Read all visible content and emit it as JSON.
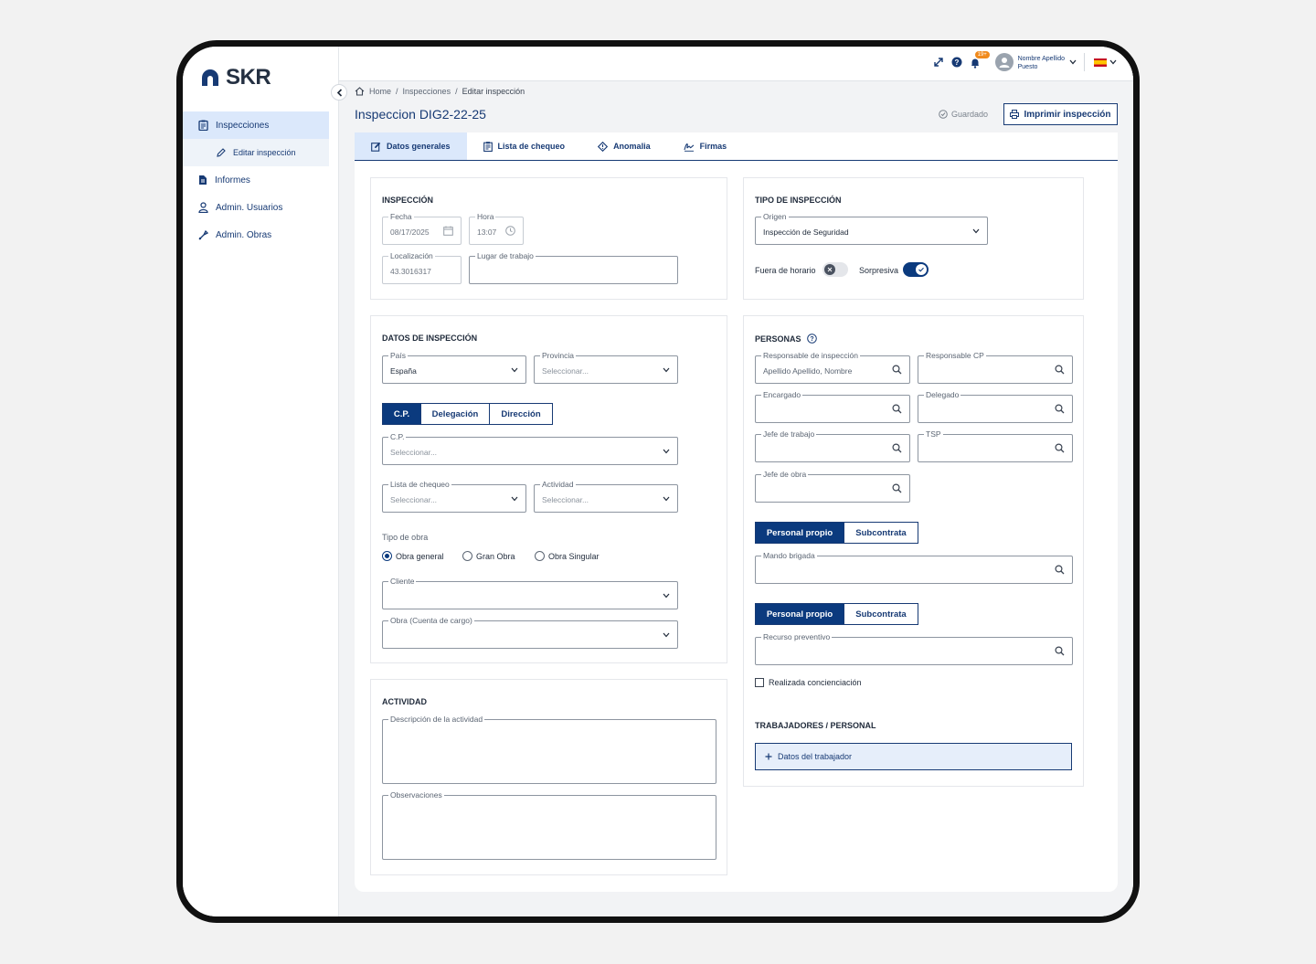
{
  "brand": {
    "name": "SKR",
    "color": "#173a74"
  },
  "sidebar": {
    "items": [
      {
        "label": "Inspecciones",
        "icon": "clipboard-icon",
        "active": true
      },
      {
        "label": "Editar inspección",
        "icon": "pencil-icon",
        "sub": true
      },
      {
        "label": "Informes",
        "icon": "report-icon"
      },
      {
        "label": "Admin. Usuarios",
        "icon": "user-icon"
      },
      {
        "label": "Admin. Obras",
        "icon": "tool-icon"
      }
    ]
  },
  "topbar": {
    "notifications_badge": "19+",
    "user_name": "Nombre Apellido",
    "user_role": "Puesto",
    "language_flag": "es-flag-icon"
  },
  "breadcrumb": [
    "Home",
    "Inspecciones",
    "Editar inspección"
  ],
  "header": {
    "title": "Inspeccion DIG2-22-25",
    "saved_label": "Guardado",
    "print_label": "Imprimir inspección"
  },
  "tabs": [
    {
      "label": "Datos generales",
      "icon": "edit-icon",
      "active": true
    },
    {
      "label": "Lista de chequeo",
      "icon": "checklist-icon"
    },
    {
      "label": "Anomalia",
      "icon": "warning-diamond-icon"
    },
    {
      "label": "Firmas",
      "icon": "signature-icon"
    }
  ],
  "inspeccion": {
    "title": "INSPECCIÓN",
    "fecha": {
      "label": "Fecha",
      "value": "08/17/2025"
    },
    "hora": {
      "label": "Hora",
      "value": "13:07"
    },
    "localizacion": {
      "label": "Localización",
      "value": "43.3016317"
    },
    "lugar": {
      "label": "Lugar de trabajo",
      "value": ""
    }
  },
  "tipo": {
    "title": "TIPO DE INSPECCIÓN",
    "origen": {
      "label": "Origen",
      "value": "Inspección de Seguridad"
    },
    "fuera_horario": {
      "label": "Fuera de horario",
      "on": false
    },
    "sorpresiva": {
      "label": "Sorpresiva",
      "on": true
    }
  },
  "datos": {
    "title": "DATOS DE INSPECCIÓN",
    "pais": {
      "label": "País",
      "value": "España"
    },
    "provincia": {
      "label": "Provincia",
      "placeholder": "Seleccionar..."
    },
    "segment": [
      "C.P.",
      "Delegación",
      "Dirección"
    ],
    "cp": {
      "label": "C.P.",
      "placeholder": "Seleccionar..."
    },
    "lista": {
      "label": "Lista de chequeo",
      "placeholder": "Seleccionar..."
    },
    "actividad": {
      "label": "Actividad",
      "placeholder": "Seleccionar..."
    },
    "tipo_obra_label": "Tipo de obra",
    "tipo_obra": [
      "Obra general",
      "Gran Obra",
      "Obra Singular"
    ],
    "cliente": {
      "label": "Cliente"
    },
    "obra": {
      "label": "Obra (Cuenta de cargo)"
    }
  },
  "actividad": {
    "title": "ACTIVIDAD",
    "descripcion": {
      "label": "Descripción de la actividad"
    },
    "observaciones": {
      "label": "Observaciones"
    }
  },
  "personas": {
    "title": "PERSONAS",
    "responsable": {
      "label": "Responsable de inspección",
      "value": "Apellido Apellido, Nombre"
    },
    "responsable_cp": {
      "label": "Responsable CP"
    },
    "encargado": {
      "label": "Encargado"
    },
    "delegado": {
      "label": "Delegado"
    },
    "jefe_trabajo": {
      "label": "Jefe de trabajo"
    },
    "tsp": {
      "label": "TSP"
    },
    "jefe_obra": {
      "label": "Jefe de obra"
    },
    "segment": [
      "Personal propio",
      "Subcontrata"
    ],
    "mando": {
      "label": "Mando brigada"
    },
    "recurso": {
      "label": "Recurso preventivo"
    },
    "concienciacion": "Realizada concienciación",
    "trabajadores_title": "TRABAJADORES / PERSONAL",
    "add_worker": "Datos del trabajador"
  }
}
